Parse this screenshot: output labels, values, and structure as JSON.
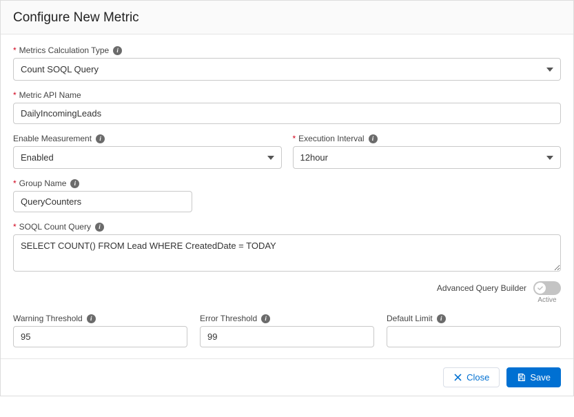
{
  "header": {
    "title": "Configure New Metric"
  },
  "fields": {
    "calcType": {
      "label": "Metrics Calculation Type",
      "required": true,
      "hasInfo": true,
      "value": "Count SOQL Query"
    },
    "apiName": {
      "label": "Metric API Name",
      "required": true,
      "hasInfo": false,
      "value": "DailyIncomingLeads"
    },
    "enableMeasurement": {
      "label": "Enable Measurement",
      "required": false,
      "hasInfo": true,
      "value": "Enabled"
    },
    "executionInterval": {
      "label": "Execution Interval",
      "required": true,
      "hasInfo": true,
      "value": "12hour"
    },
    "groupName": {
      "label": "Group Name",
      "required": true,
      "hasInfo": true,
      "value": "QueryCounters"
    },
    "soqlQuery": {
      "label": "SOQL Count Query",
      "required": true,
      "hasInfo": true,
      "value": "SELECT COUNT() FROM Lead WHERE CreatedDate = TODAY"
    },
    "warningThreshold": {
      "label": "Warning Threshold",
      "required": false,
      "hasInfo": true,
      "value": "95"
    },
    "errorThreshold": {
      "label": "Error Threshold",
      "required": false,
      "hasInfo": true,
      "value": "99"
    },
    "defaultLimit": {
      "label": "Default Limit",
      "required": false,
      "hasInfo": true,
      "value": ""
    }
  },
  "advancedQuery": {
    "label": "Advanced Query Builder",
    "enabled": false,
    "stateLabel": "Active"
  },
  "footer": {
    "close": "Close",
    "save": "Save"
  }
}
